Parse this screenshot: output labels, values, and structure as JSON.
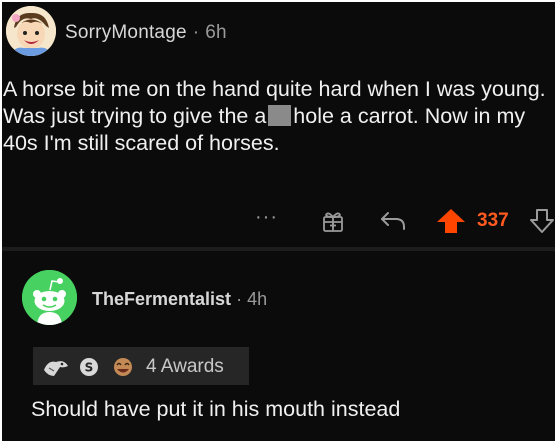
{
  "post": {
    "username": "SorryMontage",
    "separator": "·",
    "time": "6h",
    "text_before_redaction": "A horse bit me on the hand quite hard when I was young. Was just trying to give the a",
    "text_after_redaction": "hole a carrot. Now in my 40s I'm still scared of horses.",
    "more_label": "···",
    "score": "337",
    "icons": {
      "award": "gift-award-icon",
      "reply": "reply-arrow-icon",
      "upvote": "upvote-arrow-icon",
      "downvote": "downvote-arrow-icon"
    },
    "colors": {
      "background": "#0b0b0b",
      "upvoted": "#ff5a1f",
      "muted": "#9b9b9b"
    }
  },
  "reply": {
    "username": "TheFermentalist",
    "separator": "·",
    "time": "4h",
    "awards_label": "4 Awards",
    "award_icons": [
      "wholesome-seal-award-icon",
      "silver-award-icon",
      "laughing-award-icon"
    ],
    "text": "Should have put it in his mouth instead",
    "avatar_color": "#46d160"
  }
}
